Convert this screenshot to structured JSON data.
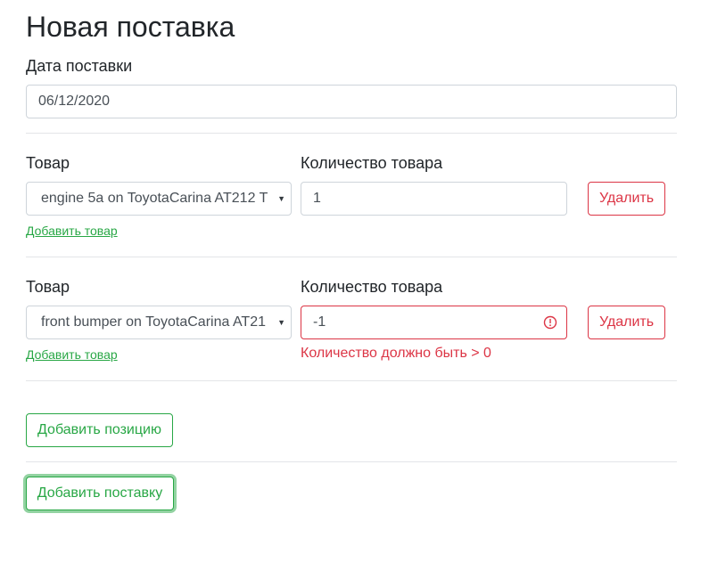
{
  "page": {
    "title": "Новая поставка"
  },
  "delivery_date": {
    "label": "Дата поставки",
    "value": "06/12/2020"
  },
  "positions": [
    {
      "product_label": "Товар",
      "product_value": "engine 5a on ToyotaCarina AT212 T",
      "quantity_label": "Количество товара",
      "quantity_value": "1",
      "delete_label": "Удалить",
      "add_product_link": "Добавить товар",
      "error": ""
    },
    {
      "product_label": "Товар",
      "product_value": "front bumper on ToyotaCarina AT21",
      "quantity_label": "Количество товара",
      "quantity_value": "-1",
      "delete_label": "Удалить",
      "add_product_link": "Добавить товар",
      "error": "Количество должно быть > 0"
    }
  ],
  "add_position_label": "Добавить позицию",
  "add_delivery_label": "Добавить поставку",
  "colors": {
    "success": "#28a745",
    "danger": "#dc3545",
    "border": "#ced4da"
  }
}
